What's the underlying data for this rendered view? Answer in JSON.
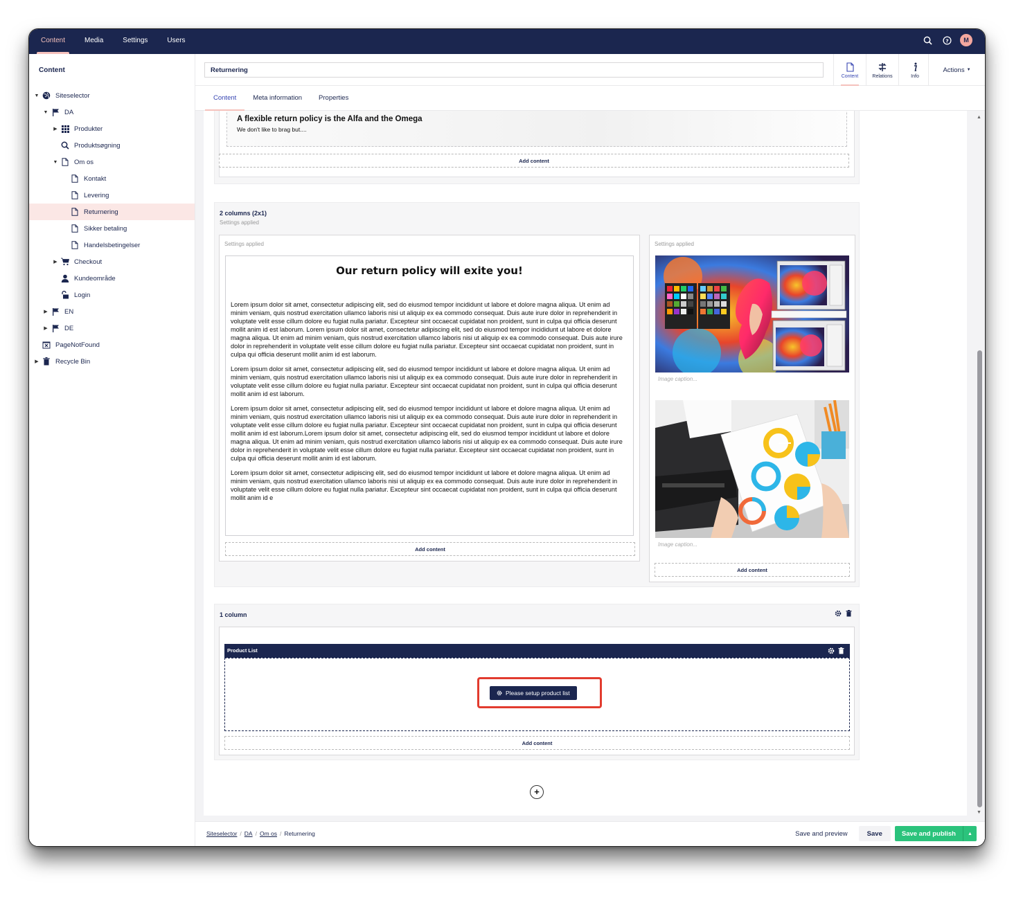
{
  "topnav": {
    "items": [
      "Content",
      "Media",
      "Settings",
      "Users"
    ],
    "active": "Content",
    "avatar_initial": "M"
  },
  "sidebar": {
    "title": "Content",
    "tree": [
      {
        "label": "Siteselector",
        "icon": "globe-icon",
        "depth": 0,
        "caret": "down"
      },
      {
        "label": "DA",
        "icon": "flag-icon",
        "depth": 1,
        "caret": "down"
      },
      {
        "label": "Produkter",
        "icon": "grid-icon",
        "depth": 2,
        "caret": "right"
      },
      {
        "label": "Produktsøgning",
        "icon": "search-icon",
        "depth": 2,
        "caret": ""
      },
      {
        "label": "Om os",
        "icon": "document-icon",
        "depth": 2,
        "caret": "down"
      },
      {
        "label": "Kontakt",
        "icon": "document-icon",
        "depth": 3,
        "caret": ""
      },
      {
        "label": "Levering",
        "icon": "document-icon",
        "depth": 3,
        "caret": ""
      },
      {
        "label": "Returnering",
        "icon": "document-icon",
        "depth": 3,
        "caret": "",
        "selected": true
      },
      {
        "label": "Sikker betaling",
        "icon": "document-icon",
        "depth": 3,
        "caret": ""
      },
      {
        "label": "Handelsbetingelser",
        "icon": "document-icon",
        "depth": 3,
        "caret": ""
      },
      {
        "label": "Checkout",
        "icon": "cart-icon",
        "depth": 2,
        "caret": "right"
      },
      {
        "label": "Kundeområde",
        "icon": "user-icon",
        "depth": 2,
        "caret": ""
      },
      {
        "label": "Login",
        "icon": "lock-icon",
        "depth": 2,
        "caret": ""
      },
      {
        "label": "EN",
        "icon": "flag-icon",
        "depth": 1,
        "caret": "right"
      },
      {
        "label": "DE",
        "icon": "flag-icon",
        "depth": 1,
        "caret": "right"
      },
      {
        "label": "PageNotFound",
        "icon": "not-found-icon",
        "depth": 0,
        "caret": ""
      },
      {
        "label": "Recycle Bin",
        "icon": "trash-icon",
        "depth": 0,
        "caret": "right"
      }
    ]
  },
  "header": {
    "name_value": "Returnering",
    "apps": [
      {
        "label": "Content",
        "icon": "document-icon"
      },
      {
        "label": "Relations",
        "icon": "relations-icon"
      },
      {
        "label": "Info",
        "icon": "info-icon"
      }
    ],
    "actions_label": "Actions"
  },
  "subtabs": [
    "Content",
    "Meta information",
    "Properties"
  ],
  "editor": {
    "top_block": {
      "heading": "A flexible return policy is the Alfa and the Omega",
      "sub": "We don't like to brag but....",
      "add_content": "Add content"
    },
    "two_col": {
      "title": "2 columns (2x1)",
      "sub": "Settings applied",
      "left_sub": "Settings applied",
      "right_sub": "Settings applied",
      "rte_heading": "Our return policy will exite you!",
      "paragraphs": [
        "Lorem ipsum dolor sit amet, consectetur adipiscing elit, sed do eiusmod tempor incididunt ut labore et dolore magna aliqua. Ut enim ad minim veniam, quis nostrud exercitation ullamco laboris nisi ut aliquip ex ea commodo consequat. Duis aute irure dolor in reprehenderit in voluptate velit esse cillum dolore eu fugiat nulla pariatur. Excepteur sint occaecat cupidatat non proident, sunt in culpa qui officia deserunt mollit anim id est laborum. Lorem ipsum dolor sit amet, consectetur adipiscing elit, sed do eiusmod tempor incididunt ut labore et dolore magna aliqua. Ut enim ad minim veniam, quis nostrud exercitation ullamco laboris nisi ut aliquip ex ea commodo consequat. Duis aute irure dolor in reprehenderit in voluptate velit esse cillum dolore eu fugiat nulla pariatur. Excepteur sint occaecat cupidatat non proident, sunt in culpa qui officia deserunt mollit anim id est laborum.",
        "Lorem ipsum dolor sit amet, consectetur adipiscing elit, sed do eiusmod tempor incididunt ut labore et dolore magna aliqua. Ut enim ad minim veniam, quis nostrud exercitation ullamco laboris nisi ut aliquip ex ea commodo consequat. Duis aute irure dolor in reprehenderit in voluptate velit esse cillum dolore eu fugiat nulla pariatur. Excepteur sint occaecat cupidatat non proident, sunt in culpa qui officia deserunt mollit anim id est laborum.",
        "Lorem ipsum dolor sit amet, consectetur adipiscing elit, sed do eiusmod tempor incididunt ut labore et dolore magna aliqua. Ut enim ad minim veniam, quis nostrud exercitation ullamco laboris nisi ut aliquip ex ea commodo consequat. Duis aute irure dolor in reprehenderit in voluptate velit esse cillum dolore eu fugiat nulla pariatur. Excepteur sint occaecat cupidatat non proident, sunt in culpa qui officia deserunt mollit anim id est laborum.Lorem ipsum dolor sit amet, consectetur adipiscing elit, sed do eiusmod tempor incididunt ut labore et dolore magna aliqua. Ut enim ad minim veniam, quis nostrud exercitation ullamco laboris nisi ut aliquip ex ea commodo consequat. Duis aute irure dolor in reprehenderit in voluptate velit esse cillum dolore eu fugiat nulla pariatur. Excepteur sint occaecat cupidatat non proident, sunt in culpa qui officia deserunt mollit anim id est laborum.",
        "Lorem ipsum dolor sit amet, consectetur adipiscing elit, sed do eiusmod tempor incididunt ut labore et dolore magna aliqua. Ut enim ad minim veniam, quis nostrud exercitation ullamco laboris nisi ut aliquip ex ea commodo consequat. Duis aute irure dolor in reprehenderit in voluptate velit esse cillum dolore eu fugiat nulla pariatur. Excepteur sint occaecat cupidatat non proident, sunt in culpa qui officia deserunt mollit anim id e"
      ],
      "caption_placeholder": "Image caption...",
      "add_content": "Add content"
    },
    "one_col": {
      "title": "1 column",
      "product_list_label": "Product List",
      "setup_button": "Please setup product list",
      "add_content": "Add content"
    }
  },
  "footer": {
    "breadcrumb": [
      "Siteselector",
      "DA",
      "Om os",
      "Returnering"
    ],
    "save_preview": "Save and preview",
    "save": "Save",
    "save_publish": "Save and publish"
  },
  "colors": {
    "brand_navy": "#1b264f",
    "accent_pink": "#f5c1bc",
    "publish_green": "#2bc37c",
    "highlight_red": "#e23b2e"
  }
}
